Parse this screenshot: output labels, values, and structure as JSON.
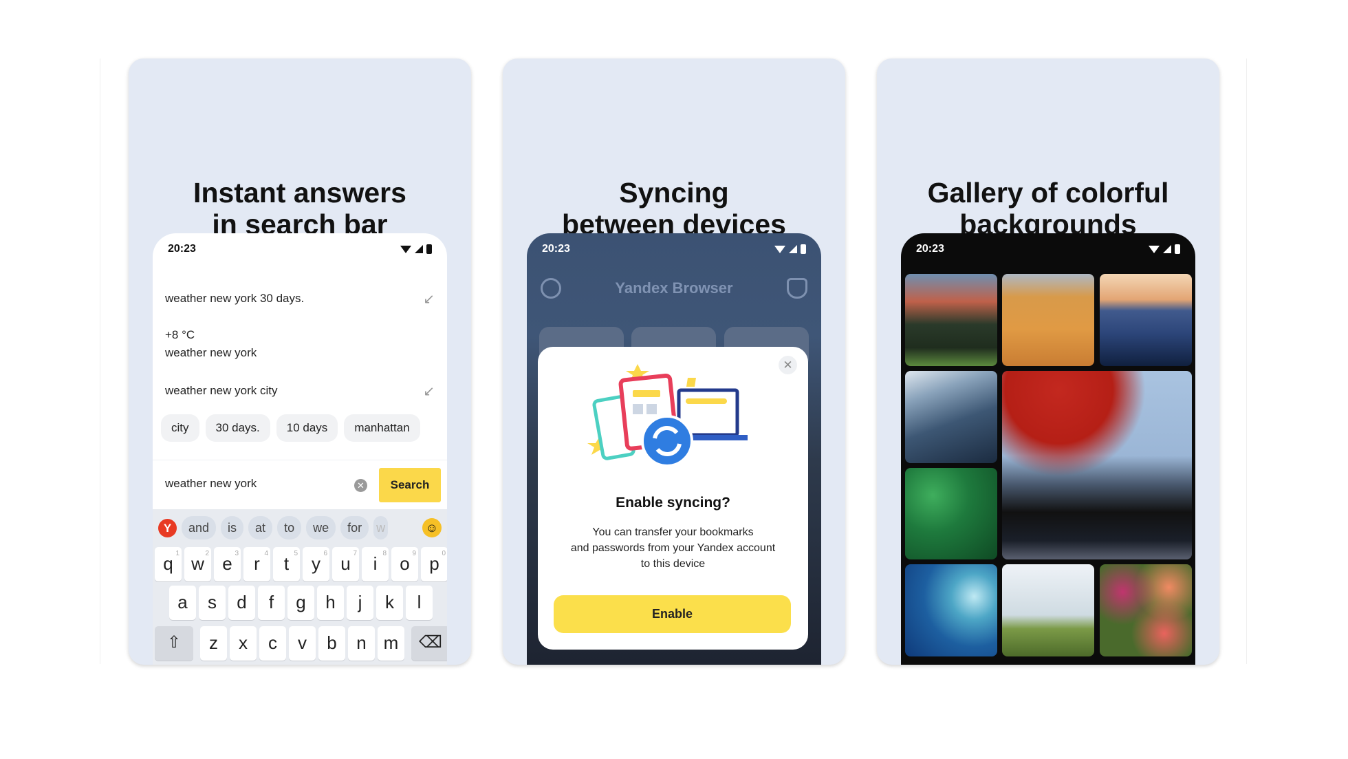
{
  "cards": [
    {
      "title_line1": "Instant answers",
      "title_line2": "in search bar"
    },
    {
      "title_line1": "Syncing",
      "title_line2": "between devices"
    },
    {
      "title_line1": "Gallery of colorful",
      "title_line2": "backgrounds"
    }
  ],
  "status_time": "20:23",
  "search": {
    "suggestions": [
      "weather new york 30 days.",
      "weather new york city"
    ],
    "weather_temp": "+8 °C",
    "weather_query": "weather new york",
    "chips": [
      "city",
      "30 days.",
      "10 days",
      "manhattan"
    ],
    "input_value": "weather new york",
    "search_button": "Search",
    "keyboard_suggestions": [
      "and",
      "is",
      "at",
      "to",
      "we",
      "for",
      "w"
    ],
    "yandex_logo": "Y",
    "row1": [
      "q",
      "w",
      "e",
      "r",
      "t",
      "y",
      "u",
      "i",
      "o",
      "p"
    ],
    "row1_digits": [
      "1",
      "2",
      "3",
      "4",
      "5",
      "6",
      "7",
      "8",
      "9",
      "0"
    ],
    "row2": [
      "a",
      "s",
      "d",
      "f",
      "g",
      "h",
      "j",
      "k",
      "l"
    ],
    "row3": [
      "z",
      "x",
      "c",
      "v",
      "b",
      "n",
      "m"
    ]
  },
  "sync": {
    "app_title": "Yandex Browser",
    "dialog_title": "Enable syncing?",
    "dialog_text_1": "You can transfer your bookmarks",
    "dialog_text_2": "and passwords from your Yandex account",
    "dialog_text_3": "to this device",
    "enable_button": "Enable"
  },
  "gallery": {
    "images": [
      "mountains",
      "desert",
      "misty-hills",
      "ice",
      "leaves",
      "mount-fuji",
      "wave",
      "forest",
      "tulips"
    ]
  },
  "colors": {
    "card_bg": "#e3e9f4",
    "accent_yellow": "#fbd84a",
    "sync_blue": "#2f7de1"
  }
}
